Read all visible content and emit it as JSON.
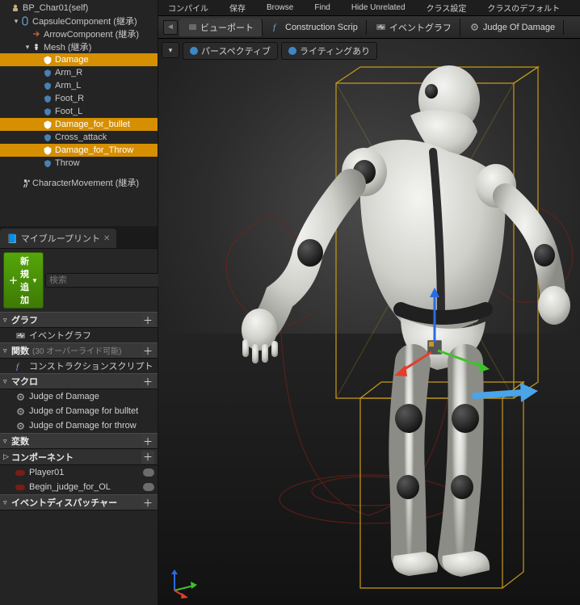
{
  "components_tree": [
    {
      "indent": 0,
      "twist": "",
      "icon": "pawn",
      "label": "BP_Char01(self)",
      "sel": false
    },
    {
      "indent": 1,
      "twist": "▾",
      "icon": "capsule",
      "label": "CapsuleComponent (継承)",
      "sel": false
    },
    {
      "indent": 2,
      "twist": "",
      "icon": "arrow",
      "label": "ArrowComponent (継承)",
      "sel": false
    },
    {
      "indent": 2,
      "twist": "▾",
      "icon": "mesh",
      "label": "Mesh (継承)",
      "sel": false
    },
    {
      "indent": 3,
      "twist": "",
      "icon": "shield",
      "label": "Damage",
      "sel": true
    },
    {
      "indent": 3,
      "twist": "",
      "icon": "shield",
      "label": "Arm_R",
      "sel": false
    },
    {
      "indent": 3,
      "twist": "",
      "icon": "shield",
      "label": "Arm_L",
      "sel": false
    },
    {
      "indent": 3,
      "twist": "",
      "icon": "shield",
      "label": "Foot_R",
      "sel": false
    },
    {
      "indent": 3,
      "twist": "",
      "icon": "shield",
      "label": "Foot_L",
      "sel": false
    },
    {
      "indent": 3,
      "twist": "",
      "icon": "shield",
      "label": "Damage_for_bullet",
      "sel": true
    },
    {
      "indent": 3,
      "twist": "",
      "icon": "shield",
      "label": "Cross_attack",
      "sel": false
    },
    {
      "indent": 3,
      "twist": "",
      "icon": "shield",
      "label": "Damage_for_Throw",
      "sel": true
    },
    {
      "indent": 3,
      "twist": "",
      "icon": "shield",
      "label": "Throw",
      "sel": false
    },
    {
      "indent": 1,
      "twist": "",
      "icon": "charmove",
      "label": "CharacterMovement (継承)",
      "sel": false
    }
  ],
  "myblueprint": {
    "tab_label": "マイブループリント",
    "add_label": "新規追加",
    "search_placeholder": "検索",
    "sections": [
      {
        "title": "グラフ",
        "hint": "",
        "type": "header",
        "items": [
          {
            "icon": "event",
            "label": "イベントグラフ"
          }
        ]
      },
      {
        "title": "関数",
        "hint": "(30 オーバーライド可能)",
        "type": "header",
        "items": [
          {
            "icon": "func",
            "label": "コンストラクションスクリプト"
          }
        ]
      },
      {
        "title": "マクロ",
        "hint": "",
        "type": "header",
        "items": [
          {
            "icon": "gear",
            "label": "Judge of Damage"
          },
          {
            "icon": "gear",
            "label": "Judge of Damage for bulltet"
          },
          {
            "icon": "gear",
            "label": "Judge of Damage for throw"
          }
        ]
      },
      {
        "title": "変数",
        "hint": "",
        "type": "header",
        "items": []
      },
      {
        "title": "コンポーネント",
        "hint": "",
        "type": "subheader",
        "items": [
          {
            "icon": "var-red",
            "label": "Player01",
            "pill": true
          },
          {
            "icon": "var-red",
            "label": "Begin_judge_for_OL",
            "pill": true
          }
        ]
      },
      {
        "title": "イベントディスパッチャー",
        "hint": "",
        "type": "header",
        "items": []
      }
    ]
  },
  "top_toolbar": {
    "items": [
      "コンパイル",
      "保存",
      "Browse",
      "Find",
      "Hide Unrelated",
      "クラス設定",
      "クラスのデフォルト"
    ]
  },
  "editor_tabs": [
    {
      "icon": "viewport",
      "label": "ビューポート",
      "active": true
    },
    {
      "icon": "func",
      "label": "Construction Scrip",
      "active": false
    },
    {
      "icon": "event",
      "label": "イベントグラフ",
      "active": false
    },
    {
      "icon": "gear",
      "label": "Judge Of Damage",
      "active": false
    }
  ],
  "viewport_buttons": {
    "perspective": "パースペクティブ",
    "lighting": "ライティングあり"
  },
  "colors": {
    "selection": "#d68f00",
    "accent_green": "#55a60a",
    "wire_yellow": "#c79a1a",
    "wire_red": "#7a2018",
    "axis_x": "#e33e2b",
    "axis_y": "#3ec22b",
    "axis_z": "#2b6be3",
    "arrow_blue": "#4aa4e8"
  }
}
